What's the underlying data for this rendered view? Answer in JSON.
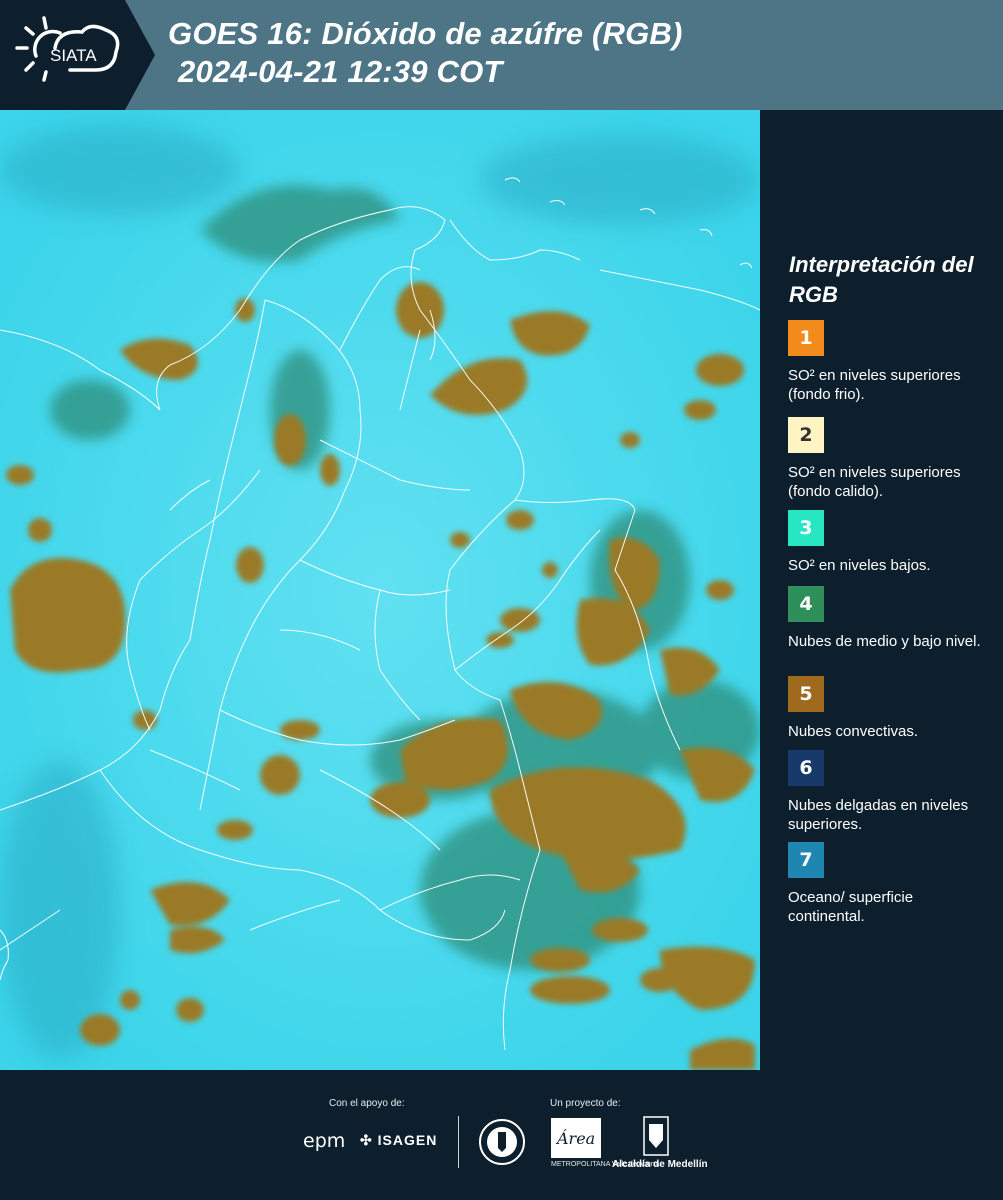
{
  "header": {
    "logo_text": "SIATA",
    "title_line1": "GOES 16: Dióxido de azúfre (RGB)",
    "title_line2": "2024-04-21 12:39 COT"
  },
  "legend": {
    "title": "Interpretación del RGB",
    "items": [
      {
        "number": "1",
        "color": "#f28a1c",
        "text_color": "#ffffff",
        "description": "SO² en niveles superiores (fondo frio)."
      },
      {
        "number": "2",
        "color": "#fff4c2",
        "text_color": "#333333",
        "description": "SO² en niveles superiores (fondo calido)."
      },
      {
        "number": "3",
        "color": "#27e6c2",
        "text_color": "#ffffff",
        "description": "SO² en niveles bajos."
      },
      {
        "number": "4",
        "color": "#2f8f5a",
        "text_color": "#ffffff",
        "description": "Nubes de medio y bajo nivel."
      },
      {
        "number": "5",
        "color": "#a06a1e",
        "text_color": "#ffffff",
        "description": "Nubes convectivas."
      },
      {
        "number": "6",
        "color": "#173a6b",
        "text_color": "#ffffff",
        "description": "Nubes delgadas en niveles superiores."
      },
      {
        "number": "7",
        "color": "#1e86b0",
        "text_color": "#ffffff",
        "description": "Oceano/ superficie continental."
      }
    ]
  },
  "footer": {
    "support_label": "Con el apoyo de:",
    "project_label": "Un proyecto de:",
    "sponsors": [
      "epm",
      "ISAGEN"
    ],
    "partners": [
      "Área Metropolitana Valle de Aburrá",
      "Alcaldía de Medellín"
    ],
    "epm_text": "epm",
    "isagen_text": "ISAGEN",
    "area_text": "Área",
    "area_subtitle": "METROPOLITANA Valle de Aburrá",
    "alcaldia_text": "Alcaldía de Medellín"
  },
  "map": {
    "product": "GOES 16 Dióxido de azúfre RGB",
    "background_color": "#3bd4ea",
    "convective_color": "#9a7a26",
    "midlevel_color": "#2e8e7a",
    "border_color": "#ffffff"
  }
}
